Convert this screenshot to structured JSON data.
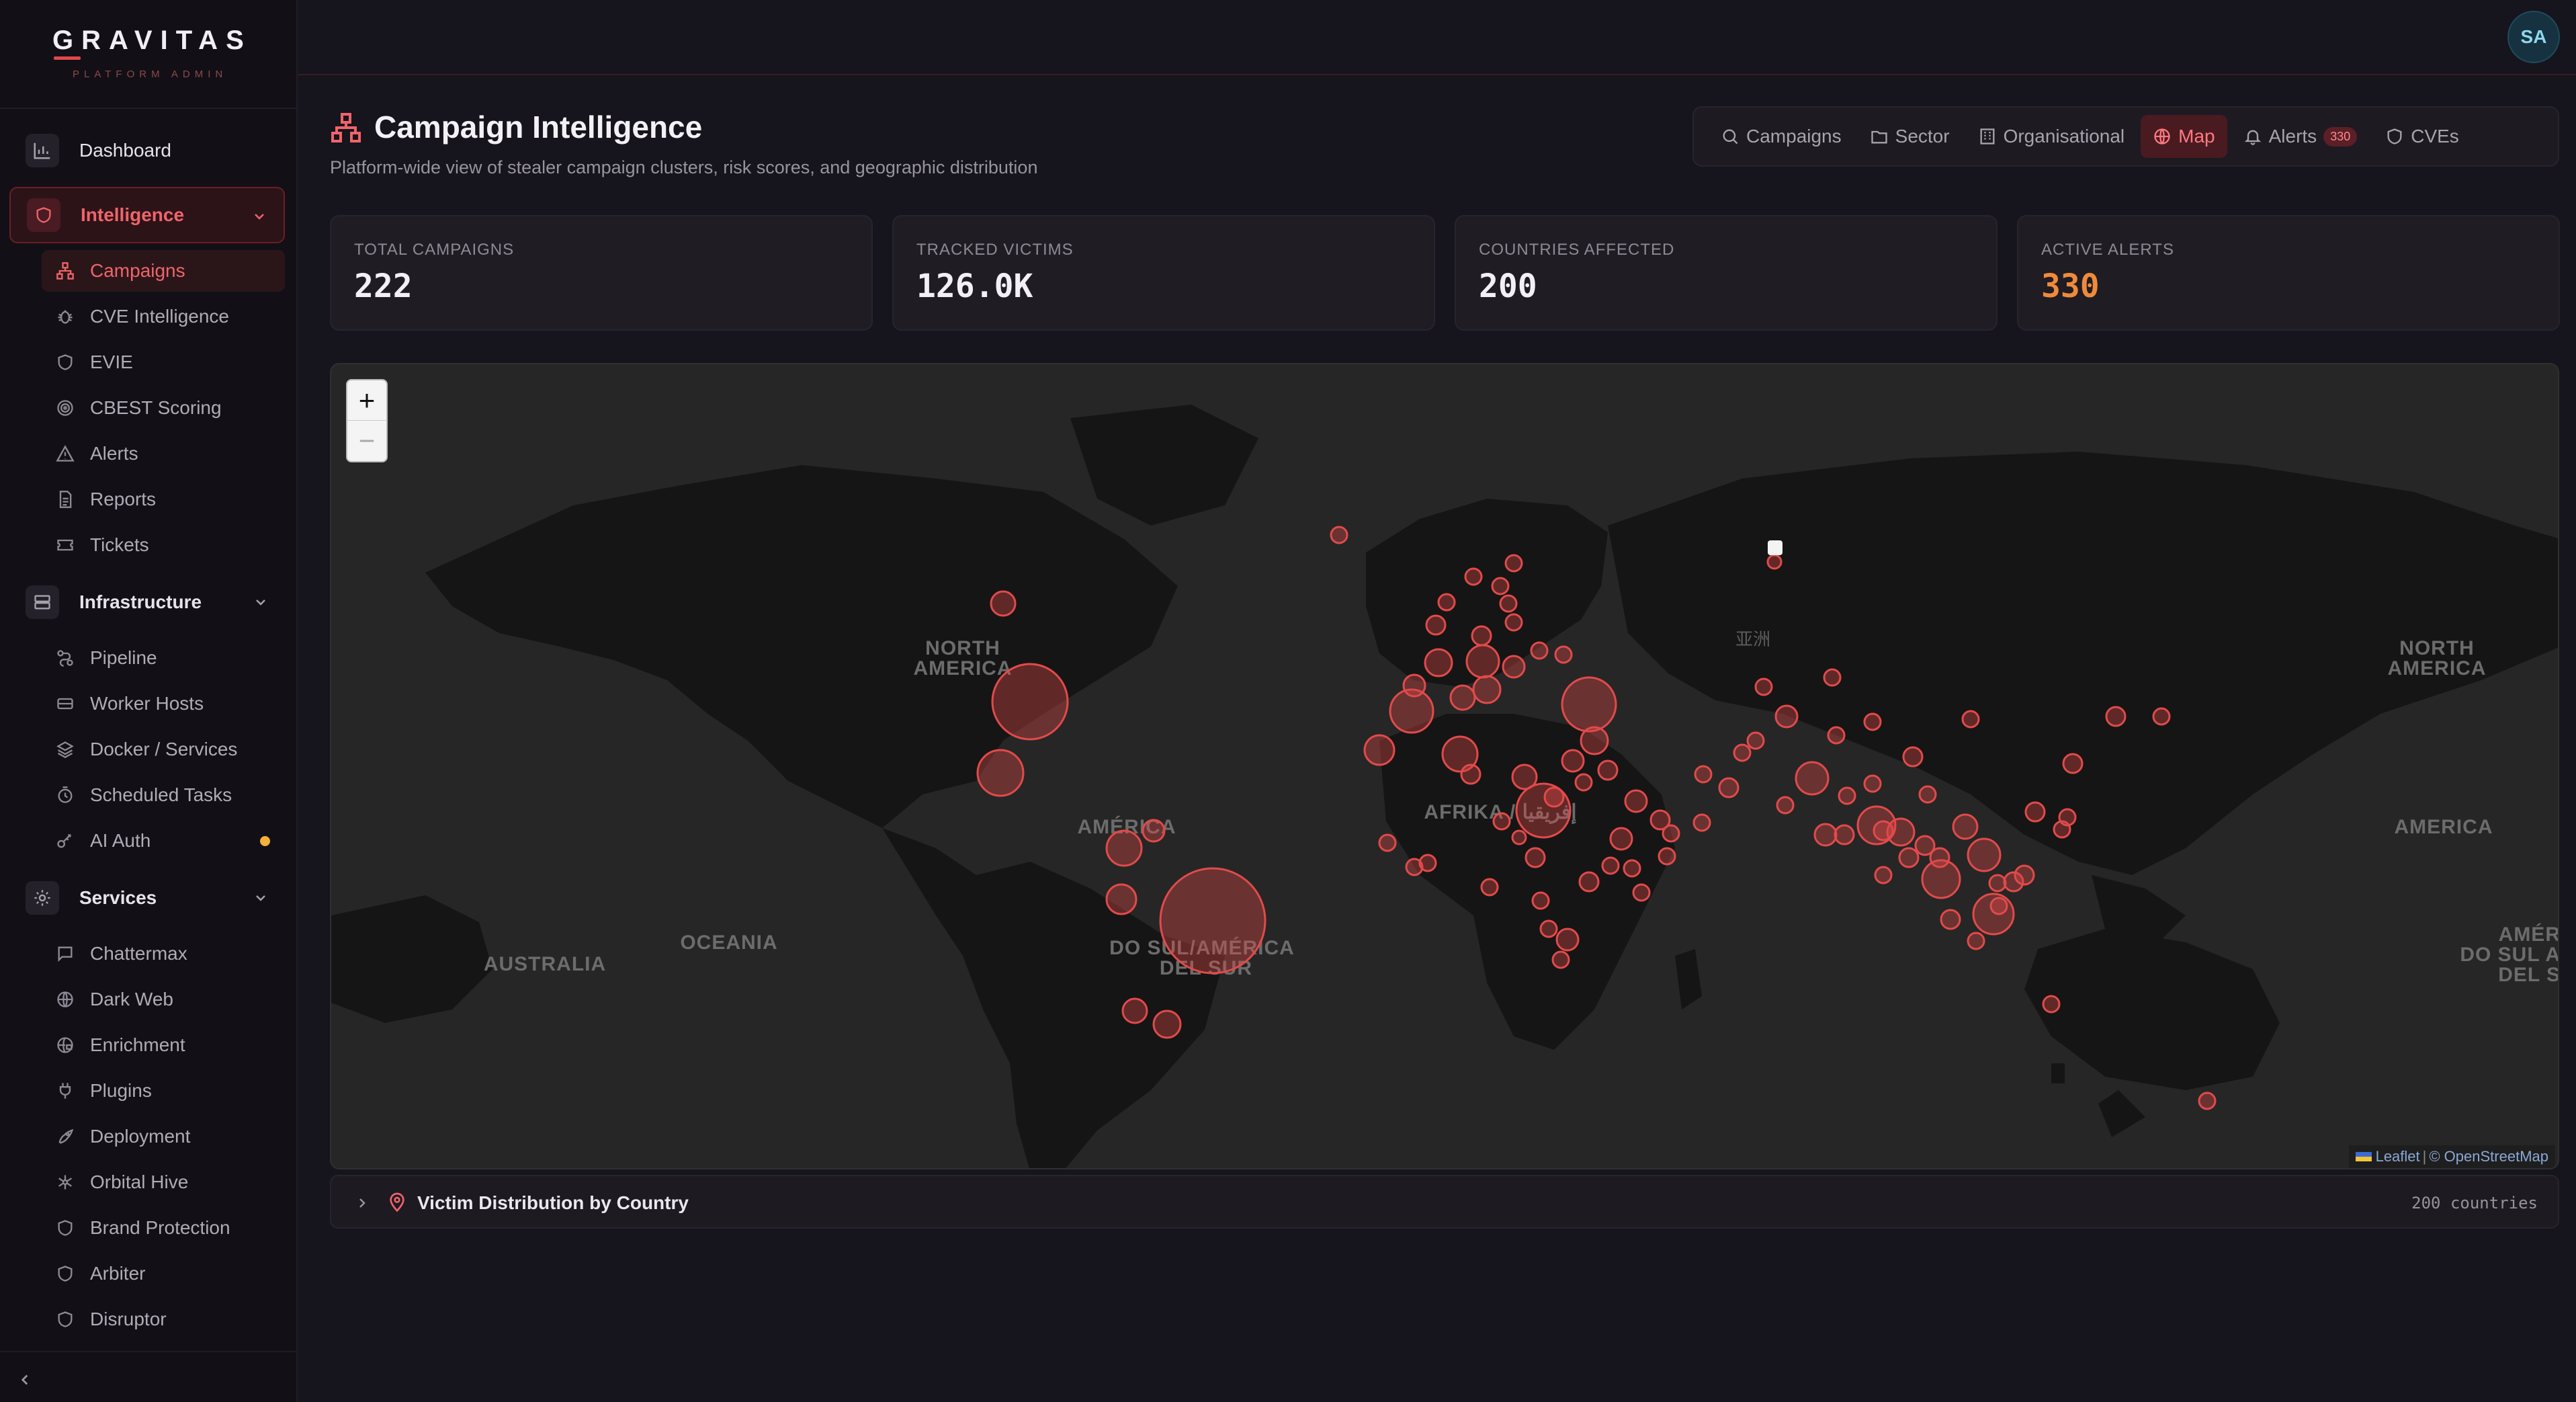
{
  "brand": {
    "name": "GRAVITAS",
    "subtitle": "PLATFORM ADMIN"
  },
  "user": {
    "initials": "SA"
  },
  "sidebar": {
    "dashboard": "Dashboard",
    "intelligence": {
      "label": "Intelligence",
      "items": [
        {
          "label": "Campaigns",
          "icon": "campaigns-icon",
          "active": true
        },
        {
          "label": "CVE Intelligence",
          "icon": "bug-icon"
        },
        {
          "label": "EVIE",
          "icon": "shield-icon"
        },
        {
          "label": "CBEST Scoring",
          "icon": "target-icon"
        },
        {
          "label": "Alerts",
          "icon": "warning-icon"
        },
        {
          "label": "Reports",
          "icon": "document-icon"
        },
        {
          "label": "Tickets",
          "icon": "ticket-icon"
        }
      ]
    },
    "infrastructure": {
      "label": "Infrastructure",
      "items": [
        {
          "label": "Pipeline",
          "icon": "pipeline-icon"
        },
        {
          "label": "Worker Hosts",
          "icon": "server-icon"
        },
        {
          "label": "Docker / Services",
          "icon": "layers-icon"
        },
        {
          "label": "Scheduled Tasks",
          "icon": "timer-icon"
        },
        {
          "label": "AI Auth",
          "icon": "key-icon",
          "indicator": true
        }
      ]
    },
    "services": {
      "label": "Services",
      "items": [
        {
          "label": "Chattermax",
          "icon": "chat-icon"
        },
        {
          "label": "Dark Web",
          "icon": "globe-icon"
        },
        {
          "label": "Enrichment",
          "icon": "globe-lock-icon"
        },
        {
          "label": "Plugins",
          "icon": "plug-icon"
        },
        {
          "label": "Deployment",
          "icon": "rocket-icon"
        },
        {
          "label": "Orbital Hive",
          "icon": "hive-icon"
        },
        {
          "label": "Brand Protection",
          "icon": "shield-icon"
        },
        {
          "label": "Arbiter",
          "icon": "shield-icon"
        },
        {
          "label": "Disruptor",
          "icon": "shield-icon"
        }
      ]
    }
  },
  "page": {
    "title": "Campaign Intelligence",
    "subtitle": "Platform-wide view of stealer campaign clusters, risk scores, and geographic distribution"
  },
  "tabs": [
    {
      "label": "Campaigns",
      "icon": "search-icon"
    },
    {
      "label": "Sector",
      "icon": "folder-icon"
    },
    {
      "label": "Organisational",
      "icon": "building-icon"
    },
    {
      "label": "Map",
      "icon": "globe-icon",
      "active": true
    },
    {
      "label": "Alerts",
      "icon": "bell-icon",
      "badge": "330"
    },
    {
      "label": "CVEs",
      "icon": "shield-icon"
    }
  ],
  "stats": [
    {
      "label": "TOTAL CAMPAIGNS",
      "value": "222"
    },
    {
      "label": "TRACKED VICTIMS",
      "value": "126.0K"
    },
    {
      "label": "COUNTRIES AFFECTED",
      "value": "200"
    },
    {
      "label": "ACTIVE ALERTS",
      "value": "330",
      "color": "#f08a3a"
    }
  ],
  "map": {
    "zoom_in": "+",
    "zoom_out": "−",
    "attribution": {
      "leaflet": "Leaflet",
      "separator": "|",
      "osm": "© OpenStreetMap"
    },
    "labels": [
      {
        "text": "NORTH",
        "kind": "major"
      },
      {
        "text": "AMERICA",
        "kind": "major"
      },
      {
        "text": "AFRIKA / إفريقيا",
        "kind": "major"
      },
      {
        "text": "AMÉRICA",
        "kind": "major"
      },
      {
        "text": "DO SUL/AMÉRICA",
        "kind": "major"
      },
      {
        "text": "DEL SUR",
        "kind": "major"
      },
      {
        "text": "AUSTRALIA",
        "kind": "major"
      },
      {
        "text": "OCEANIA",
        "kind": "major"
      },
      {
        "text": "亚洲",
        "kind": "minor"
      },
      {
        "text": "NORTH",
        "kind": "major"
      },
      {
        "text": "AMERICA",
        "kind": "major"
      },
      {
        "text": "AMERICA",
        "kind": "major"
      },
      {
        "text": "AMÉR",
        "kind": "major"
      },
      {
        "text": "DO SUL A",
        "kind": "major"
      },
      {
        "text": "DEL S",
        "kind": "major"
      }
    ]
  },
  "distribution": {
    "title": "Victim Distribution by Country",
    "count": "200 countries"
  },
  "colors": {
    "accent": "#e04848",
    "alert": "#f08a3a",
    "background": "#16141c"
  }
}
